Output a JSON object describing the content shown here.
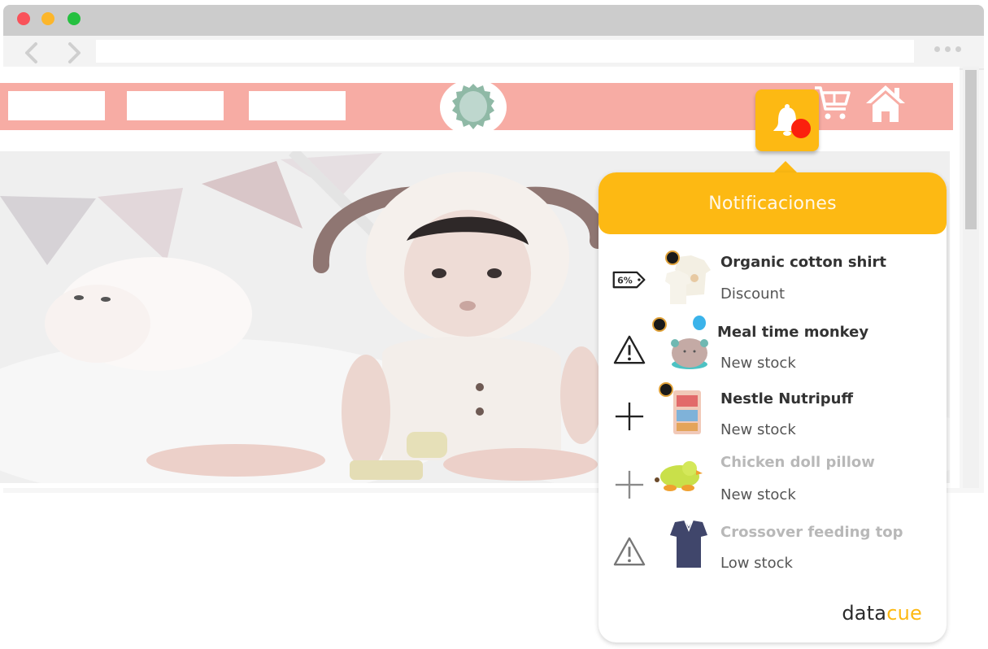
{
  "browser": {
    "window_controls": [
      "close",
      "minimize",
      "maximize"
    ],
    "nav": {
      "back_icon": "chevron-left-icon",
      "forward_icon": "chevron-right-icon"
    },
    "url": "",
    "menu_icon": "more-dots-icon"
  },
  "site": {
    "nav_blocks": 3,
    "logo_icon": "badge-logo-icon",
    "header_icons": [
      "bell-icon",
      "cart-icon",
      "home-icon"
    ],
    "colors": {
      "navbar": "#f7aca4",
      "logo_green": "#8fb9a6",
      "accent": "#fdb913",
      "badge_red": "#fb200d"
    }
  },
  "bell": {
    "icon": "bell-icon",
    "has_unread": true
  },
  "notifications": {
    "title": "Notificaciones",
    "items": [
      {
        "type_icon": "discount-tag-icon",
        "tag_text": "6%",
        "product": "Organic cotton shirt",
        "status": "Discount",
        "read": false
      },
      {
        "type_icon": "warning-icon",
        "product": "Meal time monkey",
        "status": "New stock",
        "read": false
      },
      {
        "type_icon": "plus-icon",
        "product": "Nestle Nutripuff",
        "status": "New stock",
        "read": false
      },
      {
        "type_icon": "plus-icon",
        "product": "Chicken doll pillow",
        "status": "New stock",
        "read": true
      },
      {
        "type_icon": "warning-icon",
        "product": "Crossover feeding top",
        "status": "Low stock",
        "read": true
      }
    ],
    "brand": {
      "part1": "data",
      "part2": "cue"
    }
  }
}
